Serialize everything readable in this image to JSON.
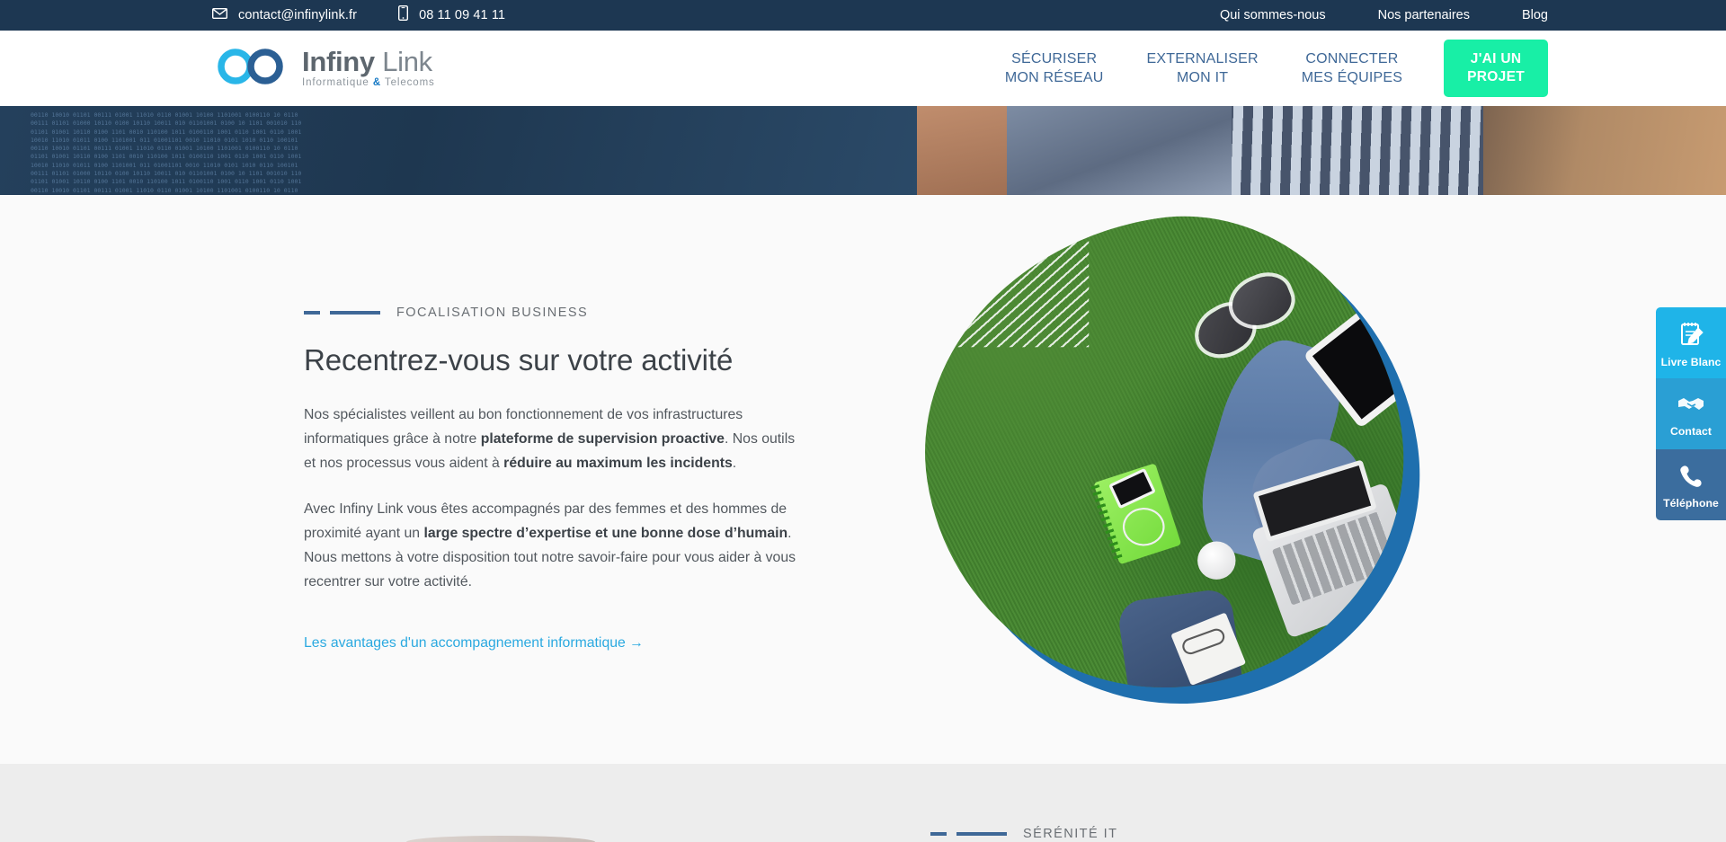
{
  "topbar": {
    "email": "contact@infinylink.fr",
    "phone": "08 11 09 41 11",
    "mail_icon": "mail-icon",
    "phone_icon": "mobile-phone-icon",
    "links": [
      {
        "label": "Qui sommes-nous"
      },
      {
        "label": "Nos partenaires"
      },
      {
        "label": "Blog"
      }
    ],
    "background_color": "#1d3752"
  },
  "header": {
    "logo": {
      "icon": "infinity-logo-icon",
      "name_bold": "Infiny",
      "name_light": " Link",
      "tagline_part1": "Informatique ",
      "tagline_amp": "&",
      "tagline_part2": " Telecoms",
      "color_light_blue": "#29b6e8",
      "color_dark_blue": "#2b5f94"
    },
    "nav": [
      {
        "line1": "SÉCURISER",
        "line2": "MON RÉSEAU"
      },
      {
        "line1": "EXTERNALISER",
        "line2": "MON IT"
      },
      {
        "line1": "CONNECTER",
        "line2": "MES ÉQUIPES"
      }
    ],
    "cta": {
      "line1": "J'AI UN",
      "line2": "PROJET",
      "color": "#18efa6"
    }
  },
  "hero_banner": {
    "alt": "banner-photo-code-and-person",
    "code_text": "00110 10010 01101 00111 01001 11010 0110 01001 10100 1101001 0100110 10 0110\n00111 01101 01000 10110 0100 10110 10011 010 01101001 0100 10 1101 001010 110\n01101 01001 10110 0100 1101 0010 110100 1011 0100110 1001 0110 1001 0110 1001\n10010 11010 01011 0100 1101001 011 01001101 0010 11010 0101 1010 0110 100101\n00110 10010 01101 00111 01001 11010 0110 01001 10100 1101001 0100110 10 0110\n01101 01001 10110 0100 1101 0010 110100 1011 0100110 1001 0110 1001 0110 1001\n10010 11010 01011 0100 1101001 011 01001101 0010 11010 0101 1010 0110 100101\n00111 01101 01000 10110 0100 10110 10011 010 01101001 0100 10 1101 001010 110\n01101 01001 10110 0100 1101 0010 110100 1011 0100110 1001 0110 1001 0110 1001\n00110 10010 01101 00111 01001 11010 0110 01001 10100 1101001 0100110 10 0110"
  },
  "main": {
    "eyebrow": "FOCALISATION BUSINESS",
    "headline": "Recentrez-vous sur votre activité",
    "paragraph1": {
      "p1": "Nos spécialistes veillent au bon fonctionnement de vos infrastructures informatiques grâce à notre ",
      "b1": "plateforme de supervision proactive",
      "p2": ". Nos outils et nos processus vous aident à ",
      "b2": "réduire au maximum les incidents",
      "p3": "."
    },
    "paragraph2": {
      "p1": "Avec Infiny Link vous êtes accompagnés par des femmes et des hommes de proximité ayant un ",
      "b1": "large spectre d’expertise et une bonne dose d’humain",
      "p2": ". Nous mettons à votre disposition tout notre savoir-faire pour vous aider à vous recentrer sur votre activité."
    },
    "link": "Les avantages d'un accompagnement informatique →",
    "link_color": "#2aa9e0",
    "photo_alt": "aerial-photo-person-on-grass-with-laptop",
    "photo_ring_color": "#1f6fae"
  },
  "side_widgets": [
    {
      "label": "Livre Blanc",
      "icon": "notepad-pencil-icon",
      "color": "#1fb4e8"
    },
    {
      "label": "Contact",
      "icon": "handshake-icon",
      "color": "#2a9fd4"
    },
    {
      "label": "Téléphone",
      "icon": "phone-handset-icon",
      "color": "#3b6d9e"
    }
  ],
  "bottom_section": {
    "eyebrow": "SÉRÉNITÉ IT",
    "background_color": "#ededed"
  }
}
